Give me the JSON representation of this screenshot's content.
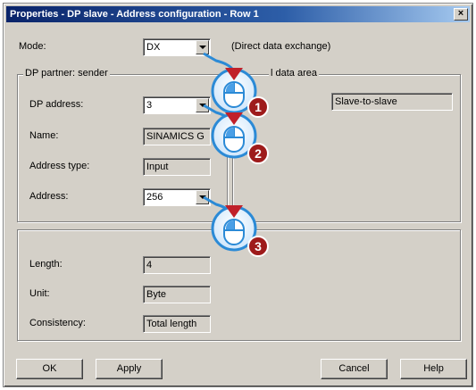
{
  "window": {
    "title": "Properties - DP slave - Address configuration - Row 1",
    "close_label": "×"
  },
  "mode": {
    "label": "Mode:",
    "value": "DX",
    "description": "(Direct data exchange)"
  },
  "sender": {
    "legend": "DP partner: sender",
    "dp_address_label": "DP address:",
    "dp_address_value": "3",
    "name_label": "Name:",
    "name_value": "SINAMICS G",
    "address_type_label": "Address type:",
    "address_type_value": "Input",
    "address_label": "Address:",
    "address_value": "256"
  },
  "local": {
    "legend": "l data area",
    "value": "Slave-to-slave"
  },
  "bottom": {
    "length_label": "Length:",
    "length_value": "4",
    "unit_label": "Unit:",
    "unit_value": "Byte",
    "consistency_label": "Consistency:",
    "consistency_value": "Total length"
  },
  "buttons": {
    "ok": "OK",
    "apply": "Apply",
    "cancel": "Cancel",
    "help": "Help"
  },
  "callouts": [
    {
      "number": "1",
      "icon": "mouse-left-click-icon"
    },
    {
      "number": "2",
      "icon": "mouse-left-click-icon"
    },
    {
      "number": "3",
      "icon": "mouse-left-click-icon"
    }
  ],
  "colors": {
    "callout_badge": "#9e1b1b",
    "callout_ring": "#2b8ad6",
    "callout_marker": "#c0202a"
  }
}
